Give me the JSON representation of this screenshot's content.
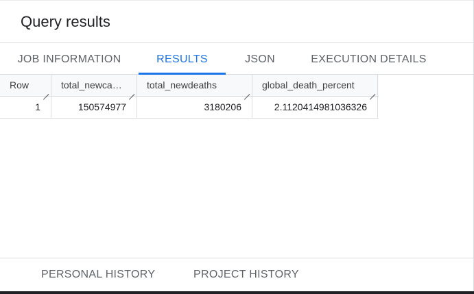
{
  "header": {
    "title": "Query results"
  },
  "tabs": [
    {
      "label": "JOB INFORMATION",
      "active": false
    },
    {
      "label": "RESULTS",
      "active": true
    },
    {
      "label": "JSON",
      "active": false
    },
    {
      "label": "EXECUTION DETAILS",
      "active": false
    }
  ],
  "table": {
    "columns": [
      "Row",
      "total_newca…",
      "total_newdeaths",
      "global_death_percent"
    ],
    "rows": [
      [
        "1",
        "150574977",
        "3180206",
        "2.1120414981036326"
      ]
    ]
  },
  "bottom_tabs": [
    {
      "label": "PERSONAL HISTORY"
    },
    {
      "label": "PROJECT HISTORY"
    }
  ],
  "colors": {
    "accent": "#1a73e8",
    "border": "#dadce0",
    "text": "#202124",
    "muted": "#5f6368"
  }
}
